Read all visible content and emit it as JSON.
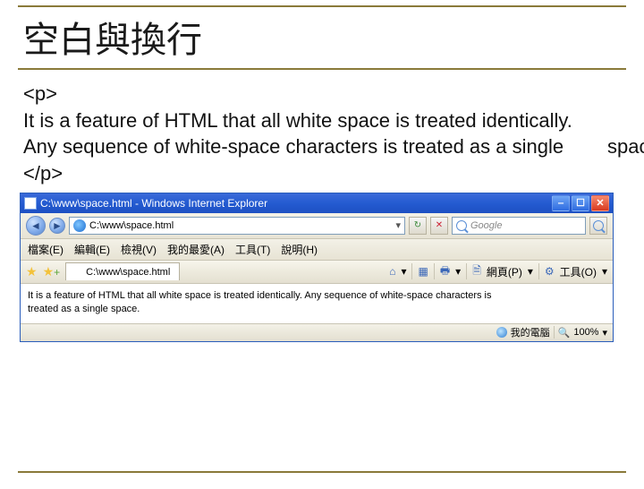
{
  "slide": {
    "title": "空白與換行",
    "code_lines": [
      "<p>",
      "It is a feature of HTML that all white space is treated identically.",
      "Any sequence of white-space characters is treated as a single        space.",
      "</p>"
    ]
  },
  "browser": {
    "window_title": "C:\\www\\space.html - Windows Internet Explorer",
    "address_url": "C:\\www\\space.html",
    "search_placeholder": "Google",
    "menu": {
      "file": "檔案(E)",
      "edit": "編輯(E)",
      "view": "檢視(V)",
      "favorites": "我的最愛(A)",
      "tools": "工具(T)",
      "help": "說明(H)"
    },
    "tab_title": "C:\\www\\space.html",
    "toolbar": {
      "home_label": "",
      "print_label": "",
      "page_label": "網頁(P)",
      "tools_label": "工具(O)"
    },
    "page_text_line1": "It is a feature of HTML that all white space is treated identically. Any sequence of white-space characters is",
    "page_text_line2": "treated as a single space.",
    "status": {
      "zone_label": "我的電腦",
      "zoom_label": "100%"
    }
  }
}
